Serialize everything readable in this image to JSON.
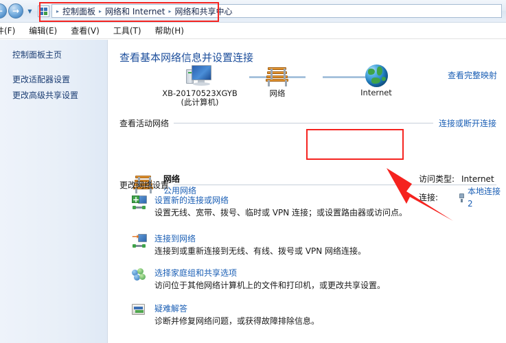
{
  "window": {
    "nav": {
      "back_label": "←",
      "forward_label": "→",
      "dropdown_label": "▼",
      "address_icon": "network-folder-icon"
    },
    "breadcrumb": {
      "leading_sep": "▸",
      "sep": "▸",
      "items": [
        "控制面板",
        "网络和 Internet",
        "网络和共享中心"
      ]
    },
    "menu": [
      {
        "label": "件(F)"
      },
      {
        "label": "编辑(E)"
      },
      {
        "label": "查看(V)"
      },
      {
        "label": "工具(T)"
      },
      {
        "label": "帮助(H)"
      }
    ]
  },
  "sidebar": {
    "items": [
      {
        "label": "控制面板主页"
      },
      {
        "label": "更改适配器设置"
      },
      {
        "label": "更改高级共享设置"
      }
    ]
  },
  "main": {
    "title": "查看基本网络信息并设置连接",
    "view_full_map_link": "查看完整映射",
    "network_map": {
      "nodes": [
        {
          "icon": "computer-monitor-icon",
          "label": "XB-20170523XGYB",
          "label2": "(此计算机)"
        },
        {
          "icon": "network-bench-icon",
          "label": "网络",
          "label2": ""
        },
        {
          "icon": "internet-globe-icon",
          "label": "Internet",
          "label2": ""
        }
      ]
    },
    "active_networks": {
      "heading": "查看活动网络",
      "right_link": "连接或断开连接",
      "network_name": "网络",
      "network_type": "公用网络",
      "info": {
        "access_type_key": "访问类型:",
        "access_type_value": "Internet",
        "connection_key": "连接:",
        "connection_value": "本地连接 2"
      }
    },
    "change_settings": {
      "heading": "更改网络设置",
      "items": [
        {
          "icon": "new-connection-icon",
          "title": "设置新的连接或网络",
          "desc": "设置无线、宽带、拨号、临时或 VPN 连接；或设置路由器或访问点。"
        },
        {
          "icon": "connect-to-network-icon",
          "title": "连接到网络",
          "desc": "连接到或重新连接到无线、有线、拨号或 VPN 网络连接。"
        },
        {
          "icon": "homegroup-icon",
          "title": "选择家庭组和共享选项",
          "desc": "访问位于其他网络计算机上的文件和打印机，或更改共享设置。"
        },
        {
          "icon": "troubleshoot-icon",
          "title": "疑难解答",
          "desc": "诊断并修复网络问题，或获得故障排除信息。"
        }
      ]
    }
  },
  "annotations": {
    "highlight_color": "#f5231f",
    "boxes": [
      "breadcrumb-highlight",
      "connection-info-highlight"
    ],
    "arrow": "red-arrow-pointing-to-connection-info"
  },
  "colors": {
    "link": "#1b5fb5",
    "title": "#1b4d9b",
    "annotation_red": "#f5231f",
    "sidebar_bg": "#e8eff8"
  }
}
